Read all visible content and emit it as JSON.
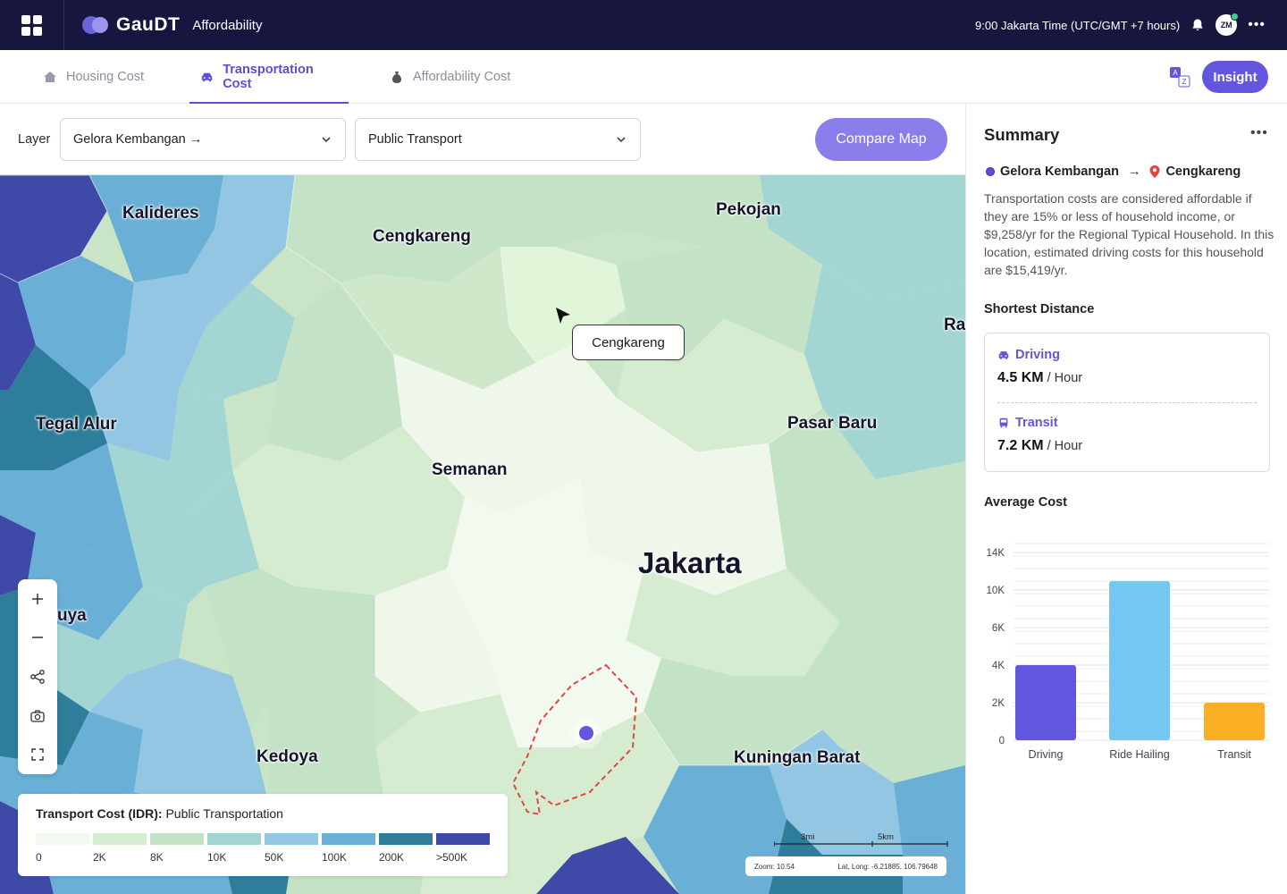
{
  "app": {
    "brand": "GauDT",
    "module": "Affordability",
    "time": "9:00 Jakarta Time (UTC/GMT +7 hours)",
    "avatar_initials": "ZM"
  },
  "tabs": [
    {
      "label": "Housing Cost",
      "icon": "house-icon",
      "active": false
    },
    {
      "label": "Transportation Cost",
      "icon": "car-icon",
      "active": true
    },
    {
      "label": "Affordability Cost",
      "icon": "money-bag-icon",
      "active": false
    }
  ],
  "insight_label": "Insight",
  "layer": {
    "label": "Layer",
    "origin_value": "Gelora Kembangan →",
    "mode_value": "Public Transport",
    "compare_label": "Compare Map"
  },
  "map": {
    "labels": {
      "kalideres": "Kalideres",
      "cengkareng": "Cengkareng",
      "pekojan": "Pekojan",
      "ra": "Ra",
      "tegal_alur": "Tegal Alur",
      "pasar_baru": "Pasar Baru",
      "semanan": "Semanan",
      "jakarta": "Jakarta",
      "uya": "uya",
      "kedoya": "Kedoya",
      "kuningan_barat": "Kuningan Barat"
    },
    "tooltip": "Cengkareng",
    "legend": {
      "title_bold": "Transport Cost (IDR):",
      "title_rest": " Public Transportation",
      "colors": [
        "#f2f9ee",
        "#d6ecd0",
        "#c3e2c6",
        "#a3d6d3",
        "#93c6e2",
        "#6aafd6",
        "#2e7e9b",
        "#3f4aa8"
      ],
      "ticks": [
        "0",
        "2K",
        "8K",
        "10K",
        "50K",
        "100K",
        "200K",
        ">500K"
      ]
    },
    "scale": {
      "mi": "3mi",
      "km": "5km"
    },
    "zoom": "Zoom: 10.54",
    "latlong": "Lat, Long: -6.21885, 106.79648"
  },
  "summary": {
    "title": "Summary",
    "from": "Gelora Kembangan",
    "to": "Cengkareng",
    "description": "Transportation costs are considered affordable if they are 15% or less of household income, or $9,258/yr for the Regional Typical Household. In this location, estimated driving costs for this household are $15,419/yr.",
    "shortest_title": "Shortest Distance",
    "driving_label": "Driving",
    "driving_value": "4.5 KM",
    "driving_unit": " / Hour",
    "transit_label": "Transit",
    "transit_value": "7.2 KM",
    "transit_unit": " / Hour",
    "avg_title": "Average Cost"
  },
  "chart_data": {
    "type": "bar",
    "categories": [
      "Driving",
      "Ride Hailing",
      "Transit"
    ],
    "values": [
      4200,
      8900,
      2100
    ],
    "colors": [
      "#6256e0",
      "#74c7f0",
      "#fbb024"
    ],
    "yticks": [
      "0",
      "2K",
      "4K",
      "6K",
      "10K",
      "14K"
    ],
    "ylim": [
      0,
      10000
    ],
    "grid": true
  }
}
